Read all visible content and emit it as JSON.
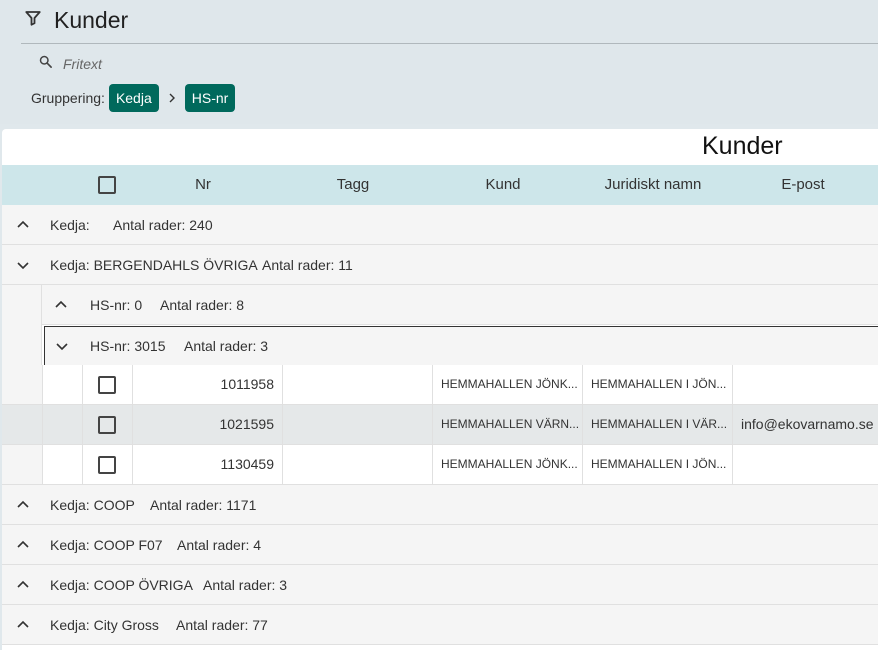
{
  "topbar": {
    "title": "Kunder",
    "search_placeholder": "Fritext",
    "grouping_label": "Gruppering:",
    "chips": [
      "Kedja",
      "HS-nr"
    ]
  },
  "panel": {
    "title": "Kunder",
    "columns": [
      "Nr",
      "Tagg",
      "Kund",
      "Juridiskt namn",
      "E-post"
    ]
  },
  "groups": {
    "g1": {
      "label": "Kedja:",
      "count": "Antal rader: 240",
      "expanded": false
    },
    "g2": {
      "label": "Kedja: BERGENDAHLS ÖVRIGA",
      "count": "Antal rader: 11",
      "expanded": true
    },
    "g2a": {
      "label": "HS-nr: 0",
      "count": "Antal rader: 8",
      "expanded": false
    },
    "g2b": {
      "label": "HS-nr: 3015",
      "count": "Antal rader: 3",
      "expanded": true
    },
    "g3": {
      "label": "Kedja: COOP",
      "count": "Antal rader: 1171",
      "expanded": false
    },
    "g4": {
      "label": "Kedja: COOP F07",
      "count": "Antal rader: 4",
      "expanded": false
    },
    "g5": {
      "label": "Kedja: COOP ÖVRIGA",
      "count": "Antal rader: 3",
      "expanded": false
    },
    "g6": {
      "label": "Kedja: City Gross",
      "count": "Antal rader: 77",
      "expanded": false
    }
  },
  "rows": [
    {
      "nr": "1011958",
      "tagg": "",
      "kund": "HEMMAHALLEN JÖNK...",
      "juridiskt": "HEMMAHALLEN I JÖN...",
      "epost": ""
    },
    {
      "nr": "1021595",
      "tagg": "",
      "kund": "HEMMAHALLEN VÄRN...",
      "juridiskt": "HEMMAHALLEN I VÄR...",
      "epost": "info@ekovarnamo.se"
    },
    {
      "nr": "1130459",
      "tagg": "",
      "kund": "HEMMAHALLEN JÖNK...",
      "juridiskt": "HEMMAHALLEN I JÖN...",
      "epost": ""
    }
  ],
  "icons": {
    "filter": "filter-icon",
    "search": "search-icon",
    "separator": "chevron-right-icon",
    "collapsed": "chevron-up-icon",
    "expanded": "chevron-down-icon",
    "checkbox": "checkbox-icon"
  },
  "colors": {
    "chip": "#00695c",
    "header": "#cde6ea",
    "topbar": "#dfe7eb"
  }
}
